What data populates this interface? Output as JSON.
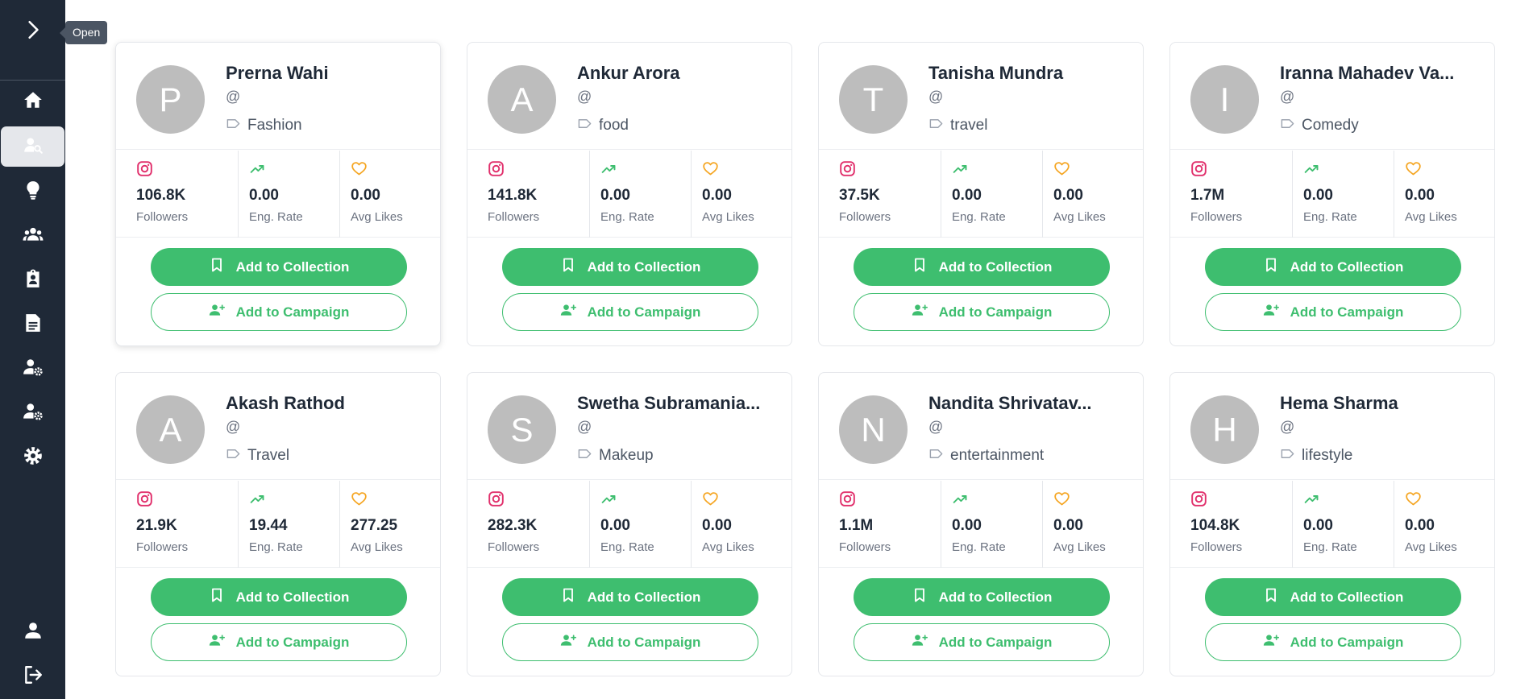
{
  "sidebar": {
    "toggle_icon": "chevron-right-icon",
    "tooltip": "Open",
    "items": [
      {
        "icon": "home-icon",
        "active": false
      },
      {
        "icon": "user-search-icon",
        "active": true
      },
      {
        "icon": "lightbulb-icon",
        "active": false
      },
      {
        "icon": "users-icon",
        "active": false
      },
      {
        "icon": "clipboard-user-icon",
        "active": false
      },
      {
        "icon": "document-icon",
        "active": false
      },
      {
        "icon": "user-gear-icon",
        "active": false
      },
      {
        "icon": "user-gear-icon",
        "active": false
      },
      {
        "icon": "gear-icon",
        "active": false
      }
    ],
    "bottom_items": [
      {
        "icon": "user-icon"
      },
      {
        "icon": "logout-icon"
      }
    ]
  },
  "labels": {
    "followers": "Followers",
    "eng_rate": "Eng. Rate",
    "avg_likes": "Avg Likes",
    "add_to_collection": "Add to Collection",
    "add_to_campaign": "Add to Campaign"
  },
  "colors": {
    "sidebar_bg": "#1f2937",
    "accent_green": "#3ebe6f",
    "instagram": "#e1306c",
    "trend_green": "#3ebe6f",
    "heart_yellow": "#f5a623",
    "avatar_gray": "#bdbdbd"
  },
  "influencers": [
    {
      "initial": "P",
      "name": "Prerna Wahi",
      "handle": "@",
      "category": "Fashion",
      "followers": "106.8K",
      "eng_rate": "0.00",
      "avg_likes": "0.00"
    },
    {
      "initial": "A",
      "name": "Ankur Arora",
      "handle": "@",
      "category": "food",
      "followers": "141.8K",
      "eng_rate": "0.00",
      "avg_likes": "0.00"
    },
    {
      "initial": "T",
      "name": "Tanisha Mundra",
      "handle": "@",
      "category": "travel",
      "followers": "37.5K",
      "eng_rate": "0.00",
      "avg_likes": "0.00"
    },
    {
      "initial": "I",
      "name": "Iranna Mahadev Va...",
      "handle": "@",
      "category": "Comedy",
      "followers": "1.7M",
      "eng_rate": "0.00",
      "avg_likes": "0.00"
    },
    {
      "initial": "A",
      "name": "Akash Rathod",
      "handle": "@",
      "category": "Travel",
      "followers": "21.9K",
      "eng_rate": "19.44",
      "avg_likes": "277.25"
    },
    {
      "initial": "S",
      "name": "Swetha Subramania...",
      "handle": "@",
      "category": "Makeup",
      "followers": "282.3K",
      "eng_rate": "0.00",
      "avg_likes": "0.00"
    },
    {
      "initial": "N",
      "name": "Nandita Shrivatav...",
      "handle": "@",
      "category": "entertainment",
      "followers": "1.1M",
      "eng_rate": "0.00",
      "avg_likes": "0.00"
    },
    {
      "initial": "H",
      "name": "Hema Sharma",
      "handle": "@",
      "category": "lifestyle",
      "followers": "104.8K",
      "eng_rate": "0.00",
      "avg_likes": "0.00"
    }
  ]
}
